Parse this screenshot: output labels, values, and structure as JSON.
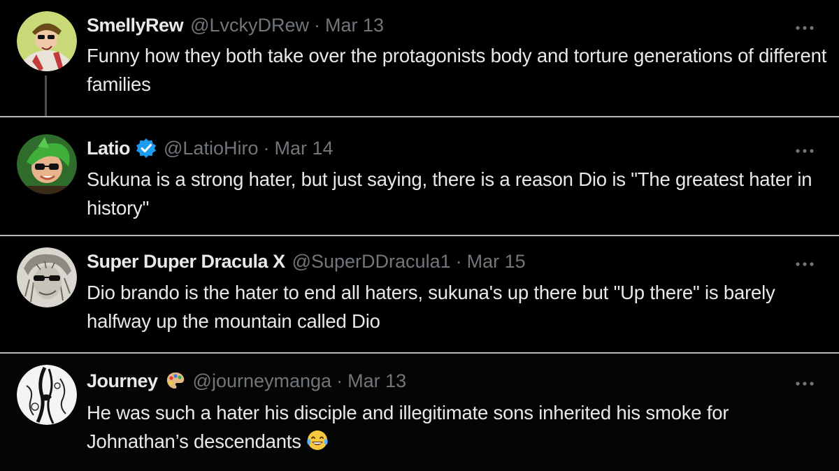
{
  "tweets": [
    {
      "name": "SmellyRew",
      "handle": "@LvckyDRew",
      "separator": "·",
      "date": "Mar 13",
      "text": "Funny how they both take over the protagonists body and torture generations of different families",
      "verified": false,
      "avatar_icon": "anime-character-avatar",
      "has_thread_line": true
    },
    {
      "name": "Latio",
      "handle": "@LatioHiro",
      "separator": "·",
      "date": "Mar 14",
      "text": "Sukuna is a strong hater, but just saying, there is a reason Dio is \"The greatest hater in history\"",
      "verified": true,
      "verified_icon": "verified-badge-icon",
      "avatar_icon": "green-haired-character-avatar"
    },
    {
      "name": "Super Duper Dracula X",
      "handle": "@SuperDDracula1",
      "separator": "·",
      "date": "Mar 15",
      "text": "Dio brando is the hater to end all haters, sukuna's up there but \"Up there\" is barely halfway up the mountain called Dio",
      "verified": false,
      "avatar_icon": "sunglasses-sketch-avatar"
    },
    {
      "name": "Journey",
      "handle": "@journeymanga",
      "separator": "·",
      "date": "Mar 13",
      "name_emoji_icon": "artist-palette-icon",
      "text": "He was such a hater his disciple and illegitimate sons inherited his smoke for Johnathan’s descendants",
      "trailing_emoji_icon": "tears-of-joy-emoji-icon",
      "verified": false,
      "avatar_icon": "ink-drawing-avatar"
    }
  ],
  "more_icon": "more-options-icon",
  "colors": {
    "background": "#000000",
    "text": "#e7e9ea",
    "muted": "#71767b",
    "verified": "#1d9bf0",
    "separator": "#b9b9b9"
  }
}
